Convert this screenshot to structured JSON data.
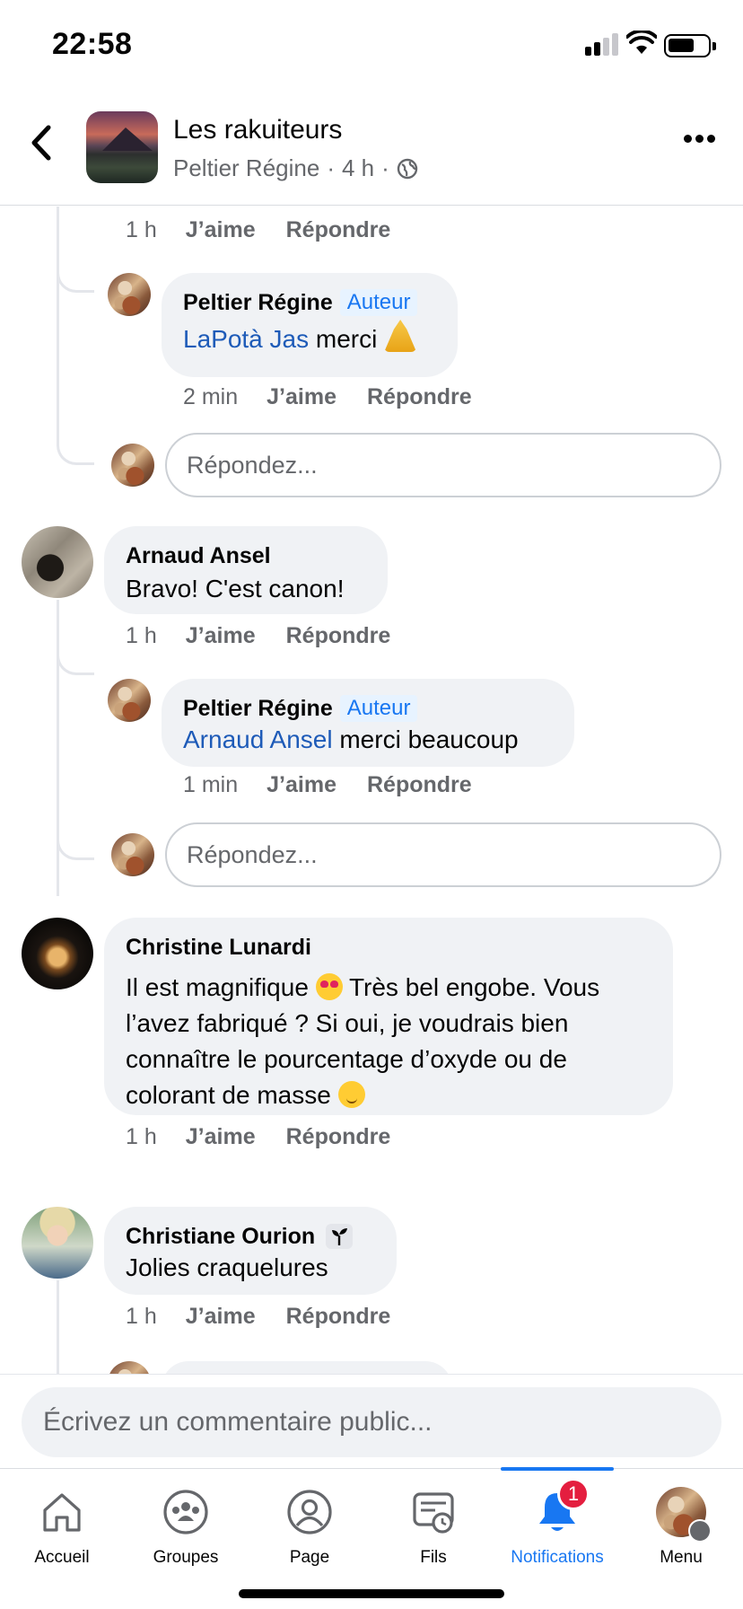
{
  "status_bar": {
    "time": "22:58"
  },
  "header": {
    "group_name": "Les rakuiteurs",
    "author": "Peltier Régine",
    "age": "4 h",
    "separator": "·"
  },
  "thread": {
    "top_actions": {
      "time": "1 h",
      "like": "J’aime",
      "reply": "Répondre"
    },
    "reply_placeholder": "Répondez...",
    "comments": [
      {
        "id": "regine-reply-1",
        "name": "Peltier Régine",
        "badge": "Auteur",
        "mention": "LaPotà Jas",
        "text": "merci",
        "emoji": "pray",
        "time": "2 min",
        "like": "J’aime",
        "reply": "Répondre"
      },
      {
        "id": "arnaud",
        "name": "Arnaud Ansel",
        "text": "Bravo! C'est canon!",
        "time": "1 h",
        "like": "J’aime",
        "reply": "Répondre"
      },
      {
        "id": "regine-reply-2",
        "name": "Peltier Régine",
        "badge": "Auteur",
        "mention": "Arnaud Ansel",
        "text": "merci beaucoup",
        "time": "1 min",
        "like": "J’aime",
        "reply": "Répondre"
      },
      {
        "id": "christine",
        "name": "Christine Lunardi",
        "text_line1_a": "Il est magnifique",
        "text_line1_b": "Très bel engobe. Vous",
        "text_line2": "l’avez fabriqué ? Si oui, je voudrais bien",
        "text_line3": "connaître le pourcentage d’oxyde ou de",
        "text_line4": "colorant de masse",
        "time": "1 h",
        "like": "J’aime",
        "reply": "Répondre"
      },
      {
        "id": "christiane",
        "name": "Christiane Ourion",
        "badge_icon": "sprout-icon",
        "text": "Jolies craquelures",
        "time": "1 h",
        "like": "J’aime",
        "reply": "Répondre"
      }
    ]
  },
  "composer": {
    "placeholder": "Écrivez un commentaire public..."
  },
  "tabbar": {
    "tabs": [
      {
        "label": "Accueil",
        "icon": "home-icon"
      },
      {
        "label": "Groupes",
        "icon": "groups-icon"
      },
      {
        "label": "Page",
        "icon": "page-icon"
      },
      {
        "label": "Fils",
        "icon": "feeds-icon"
      },
      {
        "label": "Notifications",
        "icon": "bell-icon",
        "active": true,
        "badge": "1"
      },
      {
        "label": "Menu",
        "icon": "menu-avatar"
      }
    ]
  },
  "colors": {
    "accent": "#1877f2",
    "mention": "#1e5bb8",
    "bubble": "#f0f2f5",
    "badge_red": "#e41e3f"
  }
}
